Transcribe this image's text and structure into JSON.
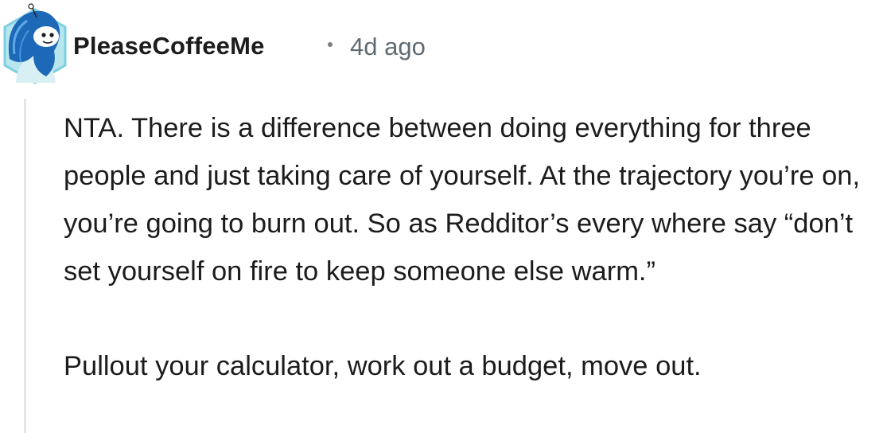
{
  "comment": {
    "author": "PleaseCoffeeMe",
    "separator": "·",
    "timestamp": "4d ago",
    "avatar_icon": "snoo-avatar-icon",
    "colors": {
      "avatar_hexagon": "#7ccfe0",
      "avatar_hair": "#1d69b8",
      "author_text": "#1c1c1c",
      "timestamp_text": "#5f6b73",
      "thread_line": "#e6e6e6"
    },
    "paragraphs": [
      "NTA. There is a difference between doing everything for three people and just taking care of yourself. At the trajectory you’re on, you’re going to burn out. So as Redditor’s every where say “don’t set yourself on fire to keep someone else warm.”",
      "Pullout your calculator, work out a budget, move out."
    ]
  }
}
